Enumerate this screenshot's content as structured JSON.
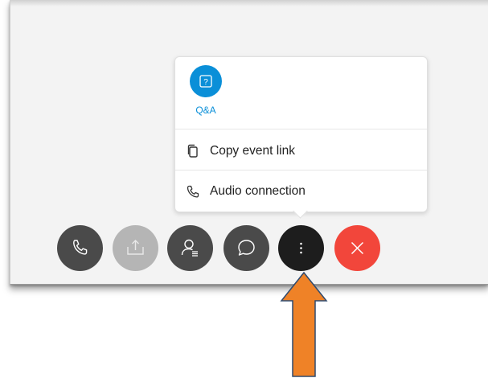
{
  "menu": {
    "qa": {
      "label": "Q&A",
      "icon": "qa-icon"
    },
    "items": [
      {
        "label": "Copy event link",
        "icon": "copy-icon"
      },
      {
        "label": "Audio connection",
        "icon": "phone-icon"
      }
    ]
  },
  "controls": [
    {
      "name": "audio",
      "icon": "phone-icon",
      "state": "normal"
    },
    {
      "name": "share",
      "icon": "share-icon",
      "state": "disabled"
    },
    {
      "name": "participants",
      "icon": "participants-icon",
      "state": "normal"
    },
    {
      "name": "chat",
      "icon": "chat-icon",
      "state": "normal"
    },
    {
      "name": "more",
      "icon": "more-options-icon",
      "state": "active"
    },
    {
      "name": "leave",
      "icon": "close-icon",
      "state": "danger"
    }
  ],
  "colors": {
    "accent": "#0a8fd8",
    "control_dark": "#4a4a4a",
    "control_disabled": "#b5b5b5",
    "control_active": "#1d1d1d",
    "leave_red": "#f2463b",
    "annotation_arrow": "#ef8227"
  }
}
